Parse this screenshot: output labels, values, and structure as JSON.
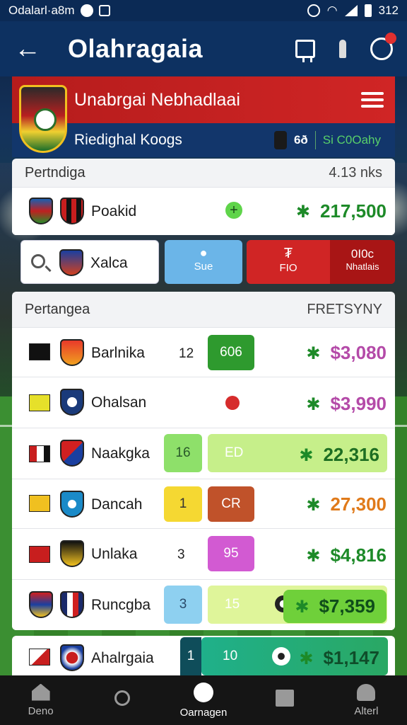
{
  "status_bar": {
    "left_text": "Odalarl·a8m",
    "time": "312"
  },
  "app_bar": {
    "back_icon": "back-arrow-icon",
    "title": "Olahragaia"
  },
  "hero": {
    "name": "Unabrgai Nebhadlaai",
    "subtitle": "Riedighal Koogs",
    "stat_number": "6ð",
    "stat_text": "Si C0Oahy"
  },
  "panel1": {
    "header_left": "Pertndiga",
    "header_right": "4.13 nks",
    "row": {
      "name": "Poakid",
      "amount": "217,500",
      "amount_color": "#1d8a28"
    }
  },
  "search_row": {
    "search_icon": "search-icon",
    "team_name": "Xalca",
    "blue_button_label": "Sue",
    "red_button_symbol": "₮",
    "red_button_label": "FIO",
    "red_button_right_top": "0I0c",
    "red_button_right_bottom": "Nhatlais"
  },
  "panel2": {
    "header_left": "Pertangea",
    "header_right": "FRETSYNY",
    "rows": [
      {
        "name": "Barlnika",
        "num": "12",
        "chip": "606",
        "chip_color": "#2e9a2e",
        "amount": "$3,080",
        "amount_color": "#b44aa8"
      },
      {
        "name": "Ohalsan",
        "num": "",
        "chip": "",
        "chip_color": "#d62c2c",
        "amount": "$3,990",
        "amount_color": "#b44aa8"
      },
      {
        "name": "Naakgka",
        "num": "16",
        "chip": "ED",
        "chip_color": "#c6ef8a",
        "amount": "22,316",
        "amount_color": "#1d6e22"
      },
      {
        "name": "Dancah",
        "num": "1",
        "chip": "CR",
        "chip_color": "#c0522a",
        "amount": "27,300",
        "amount_color": "#e07a1a"
      },
      {
        "name": "Unlaka",
        "num": "3",
        "chip": "95",
        "chip_color": "#d25ad2",
        "amount": "$4,816",
        "amount_color": "#1d8a28"
      },
      {
        "name": "Runcgba",
        "num": "3",
        "chip": "15",
        "chip_color": "#dff59a",
        "amount": "$7,359",
        "amount_color": "#1d6e22"
      }
    ]
  },
  "last_row": {
    "name": "Ahalrgaia",
    "num": "1",
    "chip": "10",
    "amount": "$1,147",
    "amount_color": "#0f4d2a"
  },
  "bottom_nav": [
    {
      "label": "Deno",
      "icon": "home-icon"
    },
    {
      "label": "",
      "icon": "search-icon"
    },
    {
      "label": "Oarnagen",
      "icon": "ball-icon"
    },
    {
      "label": "",
      "icon": "book-icon"
    },
    {
      "label": "Alterl",
      "icon": "user-icon"
    }
  ]
}
